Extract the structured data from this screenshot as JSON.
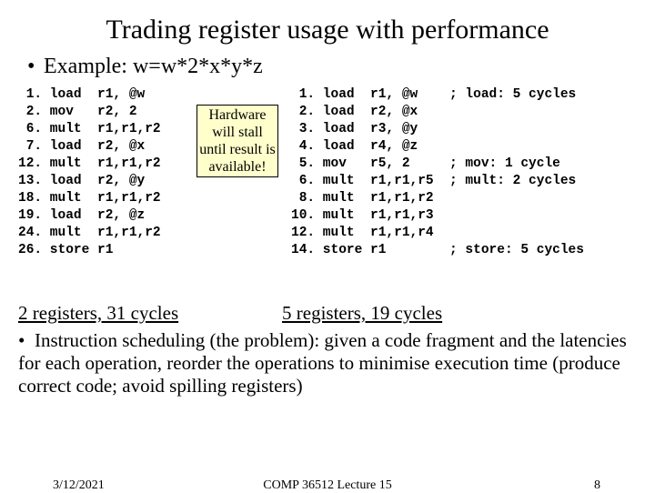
{
  "title": "Trading register usage with performance",
  "example": "Example: w=w*2*x*y*z",
  "code_left": [
    " 1. load  r1, @w",
    " 2. mov   r2, 2",
    " 6. mult  r1,r1,r2",
    " 7. load  r2, @x",
    "12. mult  r1,r1,r2",
    "13. load  r2, @y",
    "18. mult  r1,r1,r2",
    "19. load  r2, @z",
    "24. mult  r1,r1,r2",
    "26. store r1"
  ],
  "code_right": [
    " 1. load  r1, @w    ; load: 5 cycles",
    " 2. load  r2, @x",
    " 3. load  r3, @y",
    " 4. load  r4, @z",
    " 5. mov   r5, 2     ; mov: 1 cycle",
    " 6. mult  r1,r1,r5  ; mult: 2 cycles",
    " 8. mult  r1,r1,r2",
    "10. mult  r1,r1,r3",
    "12. mult  r1,r1,r4",
    "14. store r1        ; store: 5 cycles"
  ],
  "hardware_box": "Hardware will stall until result is available!",
  "caption_left": "2 registers, 31 cycles",
  "caption_right": "5 registers, 19 cycles",
  "bullet2": "Instruction scheduling (the problem): given a code fragment and the latencies for each operation, reorder the operations to minimise execution time (produce correct code; avoid spilling registers)",
  "footer": {
    "date": "3/12/2021",
    "center": "COMP 36512 Lecture 15",
    "page": "8"
  }
}
